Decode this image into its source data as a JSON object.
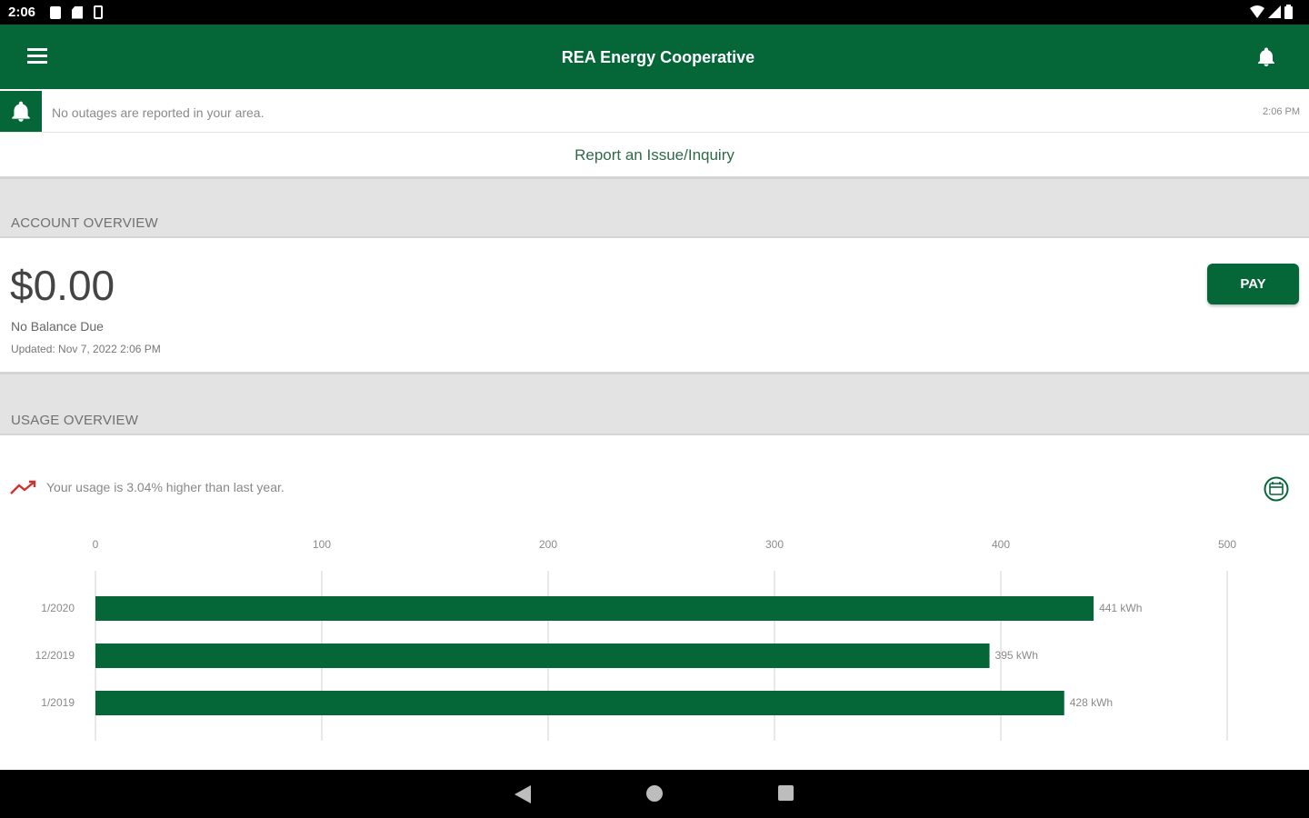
{
  "status_bar": {
    "time": "2:06"
  },
  "app_bar": {
    "title": "REA Energy Cooperative"
  },
  "outage": {
    "message": "No outages are reported in your area.",
    "time": "2:06 PM"
  },
  "report": {
    "label": "Report an Issue/Inquiry"
  },
  "account": {
    "section_title": "ACCOUNT OVERVIEW",
    "balance": "$0.00",
    "balance_label": "No Balance Due",
    "updated": "Updated: Nov 7, 2022 2:06 PM",
    "pay_label": "PAY"
  },
  "usage": {
    "section_title": "USAGE OVERVIEW",
    "trend_text": "Your usage is 3.04% higher than last year."
  },
  "colors": {
    "brand": "#056638",
    "trend": "#d32f2f",
    "gridline": "#e0e0e0"
  },
  "chart_data": {
    "type": "bar",
    "orientation": "horizontal",
    "categories": [
      "1/2020",
      "12/2019",
      "1/2019"
    ],
    "values": [
      441,
      395,
      428
    ],
    "value_labels": [
      "441 kWh",
      "395 kWh",
      "428 kWh"
    ],
    "xlim": [
      0,
      500
    ],
    "x_ticks": [
      "0",
      "100",
      "200",
      "300",
      "400",
      "500"
    ],
    "grid": true
  }
}
